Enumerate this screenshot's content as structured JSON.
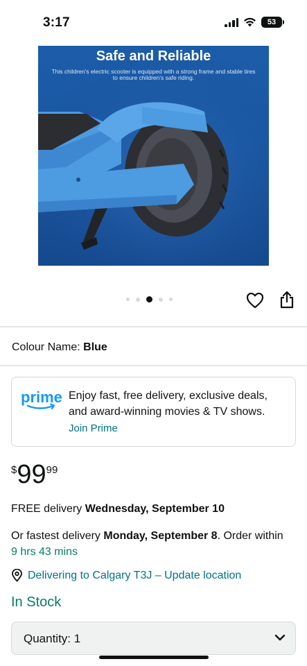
{
  "status_bar": {
    "time": "3:17",
    "battery_level": "53",
    "icons": [
      "signal-icon",
      "wifi-icon",
      "battery-icon"
    ]
  },
  "product_image": {
    "title": "Safe and Reliable",
    "subtitle": "This children's electric scooter is equipped with a strong frame and stable tires to ensure children's safe riding.",
    "background_color": "#1b5aa6",
    "scooter_color": "#4d9be0"
  },
  "carousel": {
    "total_dots": 5,
    "active_index": 2
  },
  "actions": {
    "icons": [
      "heart-icon",
      "share-icon"
    ]
  },
  "colour": {
    "label": "Colour Name:",
    "value": "Blue"
  },
  "prime": {
    "logo_text": "prime",
    "description": "Enjoy fast, free delivery, exclusive deals, and award-winning movies & TV shows.",
    "link": "Join Prime",
    "logo_color": "#1399ff"
  },
  "price": {
    "symbol": "$",
    "whole": "99",
    "fraction": "99"
  },
  "delivery": {
    "prefix": "FREE delivery ",
    "date": "Wednesday, September 10"
  },
  "fastest": {
    "prefix": "Or fastest delivery ",
    "date": "Monday, September 8",
    "middle": ". Order within ",
    "countdown": "9 hrs 43 mins"
  },
  "location": {
    "text": "Delivering to Calgary T3J – Update location"
  },
  "stock": {
    "status": "In Stock"
  },
  "quantity": {
    "label": "Quantity: 1"
  },
  "colors": {
    "link": "#007185",
    "in_stock": "#067d62",
    "text": "#0f1111",
    "border": "#d5d9d9"
  }
}
